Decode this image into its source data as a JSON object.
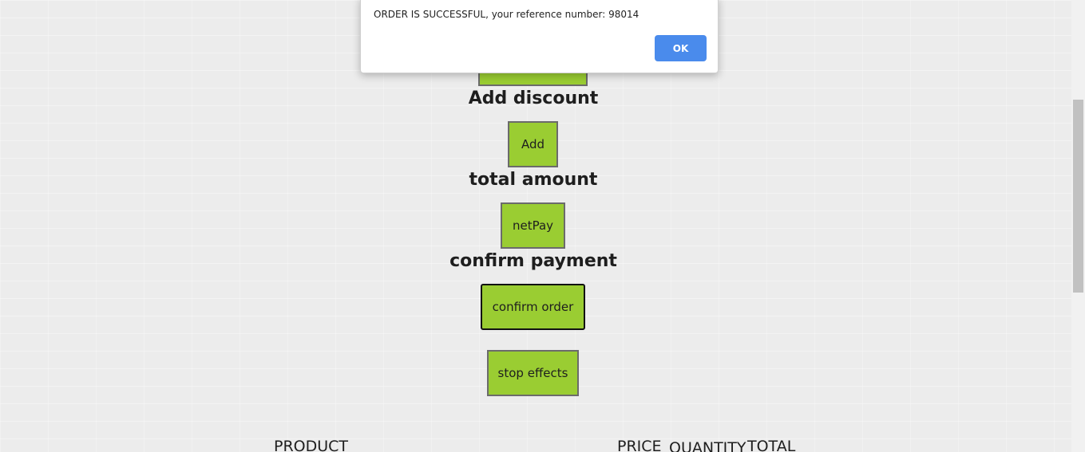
{
  "alert": {
    "message": "ORDER IS SUCCESSFUL, your reference number: 98014",
    "ok_label": "OK"
  },
  "sections": {
    "discount_heading": "Add discount",
    "discount_button": "Add",
    "total_heading": "total amount",
    "total_button": "netPay",
    "confirm_heading": "confirm payment",
    "confirm_button": "confirm order",
    "stop_button": "stop effects"
  },
  "table": {
    "headers": [
      "PRODUCT",
      "PRICE",
      "QUANTITY",
      "TOTAL"
    ]
  },
  "colors": {
    "button_bg": "#9acd32",
    "alert_ok": "#4a8bec"
  }
}
